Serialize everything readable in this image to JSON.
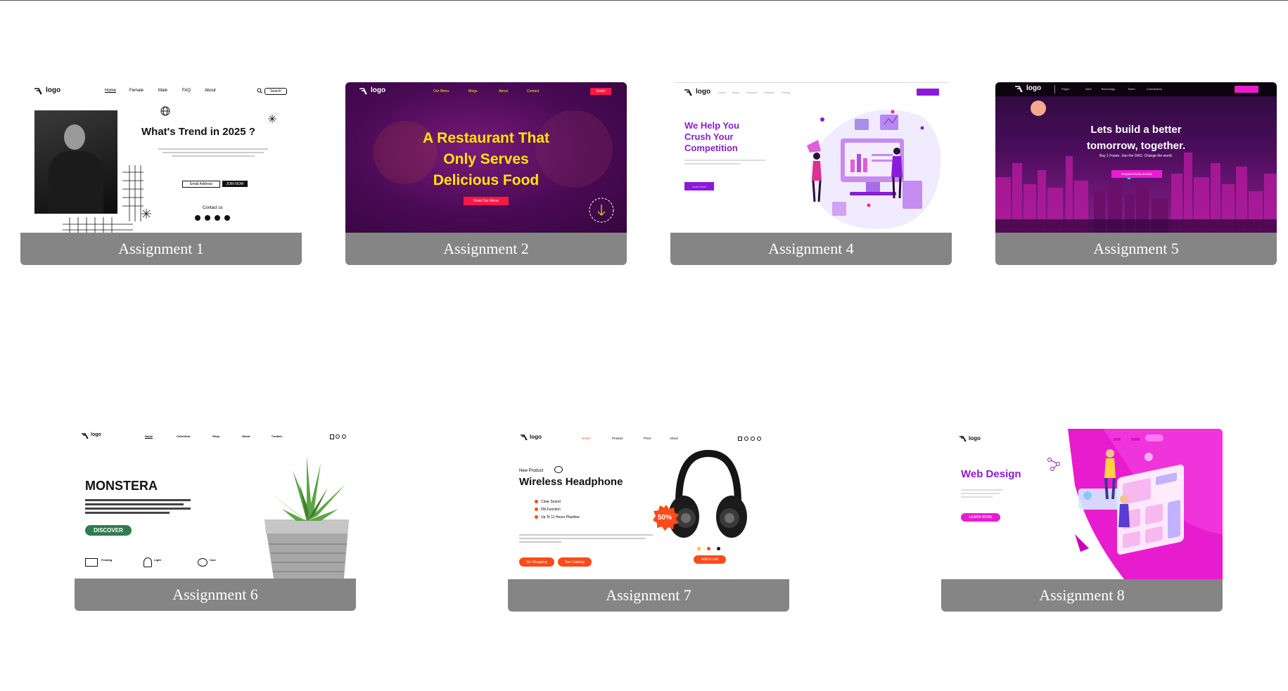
{
  "cards": [
    {
      "caption": "Assignment 1",
      "logo": "logo",
      "nav": [
        "Home",
        "Female",
        "Male",
        "FAQ",
        "About"
      ],
      "search_placeholder": "Search",
      "headline": "What's Trend in 2025 ?",
      "email_placeholder": "Email Address",
      "cta": "JOIN NOW",
      "contact": "Contact us"
    },
    {
      "caption": "Assignment 2",
      "logo": "logo",
      "nav": [
        "Our Menu",
        "Blogs",
        "About",
        "Contact"
      ],
      "order": "Order",
      "headline": [
        "A Restaurant That",
        "Only Serves",
        "Delicious Food"
      ],
      "cta": "Read Our Menu"
    },
    {
      "caption": "Assignment 4",
      "logo": "logo",
      "nav": [
        "Home",
        "About",
        "Services",
        "Portfolio",
        "Pricing"
      ],
      "headline": [
        "We Help You",
        "Crush Your",
        "Competition"
      ],
      "cta": "Learn More"
    },
    {
      "caption": "Assignment 5",
      "logo": "logo",
      "nav": [
        "Pages",
        "DAO",
        "Technology",
        "Token",
        "Contributors"
      ],
      "headline": [
        "Lets build a better",
        "tomorrow, together."
      ],
      "subline": "Buy 1 Foiam. Join the DAO. Change the world.",
      "cta": "Request Early access"
    },
    {
      "caption": "Assignment 6",
      "logo": "logo",
      "nav": [
        "Home",
        "Collection",
        "Shop",
        "About",
        "Contact"
      ],
      "headline": "MONSTERA",
      "cta": "DISCOVER",
      "features": [
        "Feeding",
        "Light",
        "Care"
      ]
    },
    {
      "caption": "Assignment 7",
      "logo": "logo",
      "nav": [
        "Home",
        "Product",
        "Price",
        "About"
      ],
      "eyebrow": "New Product",
      "headline": "Wireless Headphone",
      "features": [
        "Clear Sound",
        "FM Function",
        "Up To 11 Hours Playtime"
      ],
      "badge": "50%",
      "cta_primary": "Go Shopping",
      "cta_secondary": "See Catalog",
      "add_to_cart": "Add to cart"
    },
    {
      "caption": "Assignment 8",
      "logo": "logo",
      "headline": "Web Design",
      "cta": "LEARN MORE"
    }
  ],
  "colors": {
    "caption_bg": "#858585",
    "purple_dark": "#4a0a55",
    "magenta": "#e81ccf",
    "violet": "#8a1bd8",
    "red_accent": "#ff1744",
    "orange_accent": "#ff4a1a",
    "yellow_headline": "#ffe600"
  }
}
